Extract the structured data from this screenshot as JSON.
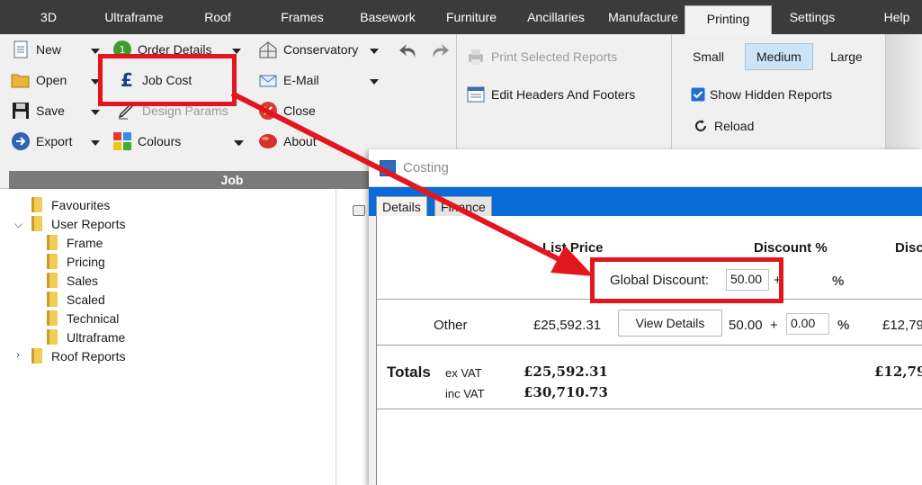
{
  "menu": {
    "tabs": [
      "3D",
      "Ultraframe",
      "Roof",
      "Frames",
      "Basework",
      "Furniture",
      "Ancillaries",
      "Manufacture",
      "Printing",
      "Settings",
      "Help"
    ]
  },
  "ribbon": {
    "job_group": {
      "title": "Job",
      "new": "New",
      "open": "Open",
      "save": "Save",
      "export": "Export",
      "order_details": "Order Details",
      "job_cost": "Job Cost",
      "design_params": "Design Params",
      "colours": "Colours",
      "conservatory": "Conservatory",
      "email": "E-Mail",
      "close": "Close",
      "about": "About"
    },
    "print_group": {
      "print_selected": "Print Selected Reports",
      "edit_headers": "Edit Headers And Footers"
    },
    "size_group": {
      "small": "Small",
      "medium": "Medium",
      "large": "Large",
      "show_hidden": "Show Hidden Reports",
      "reload": "Reload"
    }
  },
  "tree": {
    "favourites": "Favourites",
    "user_reports": "User Reports",
    "children": [
      "Frame",
      "Pricing",
      "Sales",
      "Scaled",
      "Technical",
      "Ultraframe"
    ],
    "roof_reports": "Roof Reports"
  },
  "costing": {
    "title": "Costing",
    "tabs": [
      "Details",
      "Finance"
    ],
    "list_price_header": "List Price",
    "discount_header": "Discount %",
    "disc_header_cut": "Disc",
    "global_discount_label": "Global Discount:",
    "global_discount_value": "50.00",
    "plus": "+",
    "percent": "%",
    "row": {
      "label": "Other",
      "price": "£25,592.31",
      "view_details": "View Details",
      "discount": "50.00",
      "plus": "+",
      "extra": "0.00",
      "percent": "%",
      "net_cut": "£12,79"
    },
    "totals": {
      "label": "Totals",
      "ex_vat_label": "ex VAT",
      "inc_vat_label": "inc VAT",
      "ex_vat": "£25,592.31",
      "inc_vat": "£30,710.73",
      "net_cut": "£12,79"
    }
  },
  "colors": {
    "menubar": "#3b3b3b",
    "dialog_tab_strip": "#0b6bd6",
    "annotation_red": "#e4161d"
  }
}
